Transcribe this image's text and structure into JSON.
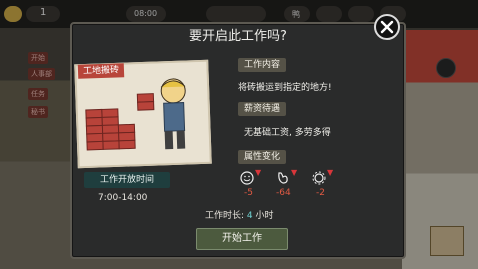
{
  "hud": {
    "coin_value": "08:00",
    "small_label": "鸭",
    "day": "1"
  },
  "side": {
    "item1": "开始",
    "item2": "人事部",
    "item3": "任务",
    "item4": "秘书"
  },
  "dialog": {
    "title": "要开启此工作吗?",
    "photo_tag": "工地搬砖",
    "content_tab": "工作内容",
    "content_text": "将砖搬运到指定的地方!",
    "salary_tab": "薪资待遇",
    "salary_text": "无基础工资, 多劳多得",
    "attr_tab": "属性变化",
    "attrs": [
      {
        "icon": "smile-face-icon",
        "value": "-5"
      },
      {
        "icon": "stomach-icon",
        "value": "-64"
      },
      {
        "icon": "gear-energy-icon",
        "value": "-2"
      }
    ],
    "open_time_label": "工作开放时间",
    "open_time_value": "7:00-14:00",
    "duration_prefix": "工作时长:",
    "duration_num": "4",
    "duration_unit": "小时",
    "start_button": "开始工作"
  },
  "colors": {
    "accent_negative": "#d8363a",
    "duration_highlight": "#6fd2d2",
    "start_bg": "#4c5a3e",
    "time_label_bg": "#1f3e3e"
  }
}
